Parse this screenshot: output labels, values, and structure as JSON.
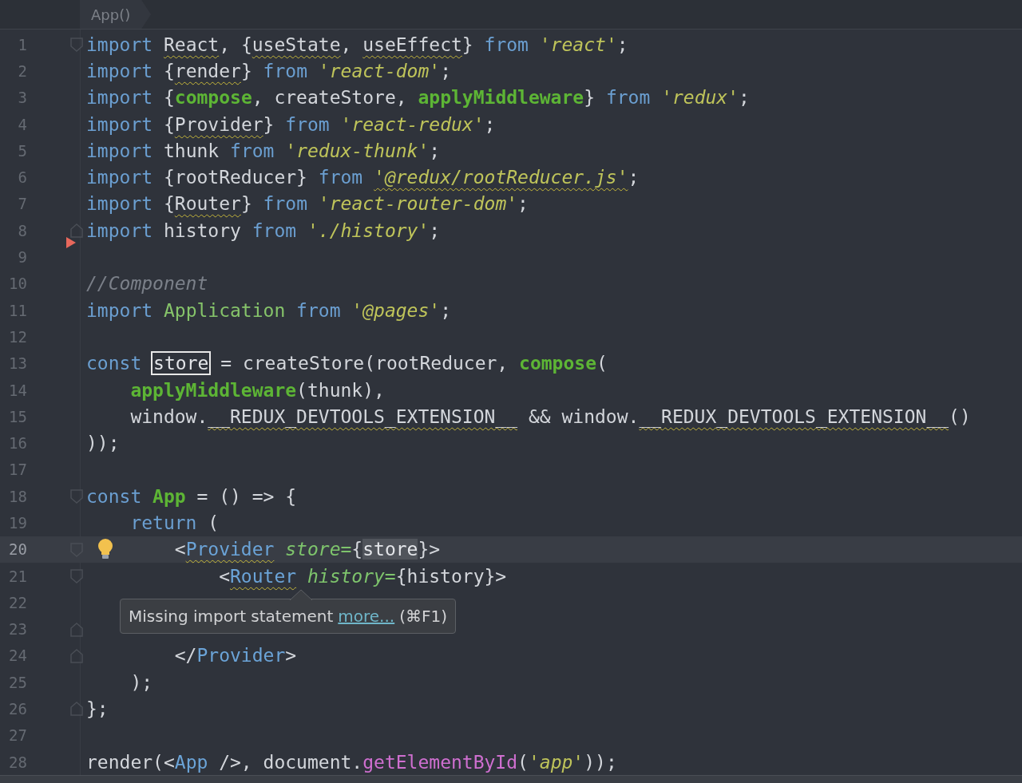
{
  "breadcrumb": {
    "label": "App()"
  },
  "lines": [
    {
      "number": "1",
      "current": false,
      "markers": [
        {
          "kind": "fold-start"
        }
      ],
      "tokens": [
        {
          "kind": "kw",
          "text": "import "
        },
        {
          "kind": "id-warn",
          "text": "React"
        },
        {
          "kind": "id",
          "text": ", {"
        },
        {
          "kind": "id-warn",
          "text": "useState"
        },
        {
          "kind": "id",
          "text": ", "
        },
        {
          "kind": "id-warn",
          "text": "useEffect"
        },
        {
          "kind": "id",
          "text": "} "
        },
        {
          "kind": "kw",
          "text": "from "
        },
        {
          "kind": "str",
          "text": "'react'"
        },
        {
          "kind": "id",
          "text": ";"
        }
      ]
    },
    {
      "number": "2",
      "current": false,
      "tokens": [
        {
          "kind": "kw",
          "text": "import "
        },
        {
          "kind": "id",
          "text": "{"
        },
        {
          "kind": "id-warn",
          "text": "render"
        },
        {
          "kind": "id",
          "text": "} "
        },
        {
          "kind": "kw",
          "text": "from "
        },
        {
          "kind": "str",
          "text": "'react-dom'"
        },
        {
          "kind": "id",
          "text": ";"
        }
      ]
    },
    {
      "number": "3",
      "current": false,
      "tokens": [
        {
          "kind": "kw",
          "text": "import "
        },
        {
          "kind": "id",
          "text": "{"
        },
        {
          "kind": "fn",
          "text": "compose"
        },
        {
          "kind": "id",
          "text": ", createStore, "
        },
        {
          "kind": "fn",
          "text": "applyMiddleware"
        },
        {
          "kind": "id",
          "text": "} "
        },
        {
          "kind": "kw",
          "text": "from "
        },
        {
          "kind": "str",
          "text": "'redux'"
        },
        {
          "kind": "id",
          "text": ";"
        }
      ]
    },
    {
      "number": "4",
      "current": false,
      "tokens": [
        {
          "kind": "kw",
          "text": "import "
        },
        {
          "kind": "id",
          "text": "{"
        },
        {
          "kind": "id-warn",
          "text": "Provider"
        },
        {
          "kind": "id",
          "text": "} "
        },
        {
          "kind": "kw",
          "text": "from "
        },
        {
          "kind": "str",
          "text": "'react-redux'"
        },
        {
          "kind": "id",
          "text": ";"
        }
      ]
    },
    {
      "number": "5",
      "current": false,
      "tokens": [
        {
          "kind": "kw",
          "text": "import "
        },
        {
          "kind": "id",
          "text": "thunk "
        },
        {
          "kind": "kw",
          "text": "from "
        },
        {
          "kind": "str",
          "text": "'redux-thunk'"
        },
        {
          "kind": "id",
          "text": ";"
        }
      ]
    },
    {
      "number": "6",
      "current": false,
      "tokens": [
        {
          "kind": "kw",
          "text": "import "
        },
        {
          "kind": "id",
          "text": "{rootReducer} "
        },
        {
          "kind": "kw",
          "text": "from "
        },
        {
          "kind": "str-warn",
          "text": "'@redux/rootReducer.js'"
        },
        {
          "kind": "id",
          "text": ";"
        }
      ]
    },
    {
      "number": "7",
      "current": false,
      "tokens": [
        {
          "kind": "kw",
          "text": "import "
        },
        {
          "kind": "id",
          "text": "{"
        },
        {
          "kind": "id-warn",
          "text": "Router"
        },
        {
          "kind": "id",
          "text": "} "
        },
        {
          "kind": "kw",
          "text": "from "
        },
        {
          "kind": "str",
          "text": "'react-router-dom'"
        },
        {
          "kind": "id",
          "text": ";"
        }
      ]
    },
    {
      "number": "8",
      "current": false,
      "markers": [
        {
          "kind": "fold-end"
        },
        {
          "kind": "breakpoint"
        }
      ],
      "tokens": [
        {
          "kind": "kw",
          "text": "import "
        },
        {
          "kind": "id",
          "text": "history "
        },
        {
          "kind": "kw",
          "text": "from "
        },
        {
          "kind": "str",
          "text": "'./history'"
        },
        {
          "kind": "id",
          "text": ";"
        }
      ]
    },
    {
      "number": "9",
      "current": false
    },
    {
      "number": "10",
      "current": false,
      "tokens": [
        {
          "kind": "comment",
          "text": "//Component"
        }
      ]
    },
    {
      "number": "11",
      "current": false,
      "tokens": [
        {
          "kind": "kw",
          "text": "import "
        },
        {
          "kind": "cls",
          "text": "Application "
        },
        {
          "kind": "kw",
          "text": "from "
        },
        {
          "kind": "str",
          "text": "'@pages'"
        },
        {
          "kind": "id",
          "text": ";"
        }
      ]
    },
    {
      "number": "12",
      "current": false
    },
    {
      "number": "13",
      "current": false,
      "tokens": [
        {
          "kind": "kw",
          "text": "const "
        },
        {
          "kind": "boxed",
          "text": "store"
        },
        {
          "kind": "id",
          "text": " = createStore(rootReducer, "
        },
        {
          "kind": "fn",
          "text": "compose"
        },
        {
          "kind": "id",
          "text": "("
        }
      ],
      "children": [
        {
          "number": "14",
          "current": false,
          "tokens": [
            {
              "kind": "fn",
              "text": "applyMiddleware"
            },
            {
              "kind": "id",
              "text": "(thunk),"
            }
          ]
        },
        {
          "number": "15",
          "current": false,
          "tokens": [
            {
              "kind": "id",
              "text": "window."
            },
            {
              "kind": "id-warn",
              "text": "__REDUX_DEVTOOLS_EXTENSION__"
            },
            {
              "kind": "id",
              "text": " && window."
            },
            {
              "kind": "id-warn",
              "text": "__REDUX_DEVTOOLS_EXTENSION__"
            },
            {
              "kind": "id",
              "text": "()"
            }
          ]
        }
      ]
    },
    {
      "number": "16",
      "current": false,
      "tokens": [
        {
          "kind": "id",
          "text": "));"
        }
      ]
    },
    {
      "number": "17",
      "current": false
    },
    {
      "number": "18",
      "current": false,
      "markers": [
        {
          "kind": "fold-start"
        }
      ],
      "tokens": [
        {
          "kind": "kw",
          "text": "const "
        },
        {
          "kind": "fn",
          "text": "App"
        },
        {
          "kind": "id",
          "text": " = () => {"
        }
      ],
      "children": [
        {
          "number": "19",
          "current": false,
          "tokens": [
            {
              "kind": "kw",
              "text": "return "
            },
            {
              "kind": "id",
              "text": "("
            }
          ],
          "children": [
            {
              "number": "20",
              "current": true,
              "markers": [
                {
                  "kind": "fold-start"
                },
                {
                  "kind": "bulb"
                }
              ],
              "tokens": [
                {
                  "kind": "id",
                  "text": "<"
                },
                {
                  "kind": "tag-warn",
                  "text": "Provider"
                },
                {
                  "kind": "attr",
                  "text": " store="
                },
                {
                  "kind": "id",
                  "text": "{"
                },
                {
                  "kind": "hl",
                  "text": "store"
                },
                {
                  "kind": "id",
                  "text": "}>"
                }
              ],
              "children": [
                {
                  "number": "21",
                  "current": false,
                  "markers": [
                    {
                      "kind": "fold-start"
                    }
                  ],
                  "tokens": [
                    {
                      "kind": "id",
                      "text": "<"
                    },
                    {
                      "kind": "tag-warn",
                      "text": "Router"
                    },
                    {
                      "kind": "attr",
                      "text": " history="
                    },
                    {
                      "kind": "id",
                      "text": "{history}>"
                    }
                  ],
                  "children": [
                    {
                      "number": "22",
                      "current": false
                    }
                  ]
                },
                {
                  "number": "23",
                  "current": false,
                  "markers": [
                    {
                      "kind": "fold-end"
                    }
                  ]
                }
              ]
            },
            {
              "number": "24",
              "current": false,
              "markers": [
                {
                  "kind": "fold-end"
                }
              ],
              "tokens": [
                {
                  "kind": "id",
                  "text": "</"
                },
                {
                  "kind": "tag",
                  "text": "Provider"
                },
                {
                  "kind": "id",
                  "text": ">"
                }
              ]
            }
          ]
        },
        {
          "number": "25",
          "current": false,
          "tokens": [
            {
              "kind": "id",
              "text": ");"
            }
          ]
        }
      ]
    },
    {
      "number": "26",
      "current": false,
      "markers": [
        {
          "kind": "fold-end"
        }
      ],
      "tokens": [
        {
          "kind": "id",
          "text": "};"
        }
      ]
    },
    {
      "number": "27",
      "current": false
    },
    {
      "number": "28",
      "current": false,
      "tokens": [
        {
          "kind": "id",
          "text": "render(<"
        },
        {
          "kind": "tag",
          "text": "App"
        },
        {
          "kind": "id",
          "text": " />, document."
        },
        {
          "kind": "method",
          "text": "getElementById"
        },
        {
          "kind": "id",
          "text": "("
        },
        {
          "kind": "str",
          "text": "'app'"
        },
        {
          "kind": "id",
          "text": "));"
        }
      ]
    }
  ],
  "tooltip": {
    "text": "Missing import statement",
    "link": "more...",
    "shortcut": "(⌘F1)"
  }
}
